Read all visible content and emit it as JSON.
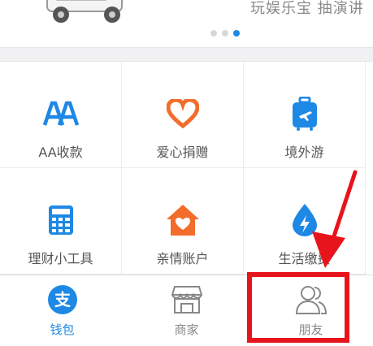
{
  "banner": {
    "text": "玩娱乐宝 抽演讲",
    "dots": 3,
    "active_dot": 3
  },
  "grid": [
    {
      "label": "AA收款",
      "icon": "aa-icon",
      "color": "#1e88e5"
    },
    {
      "label": "爱心捐赠",
      "icon": "heart-icon",
      "color": "#f26c2b"
    },
    {
      "label": "境外游",
      "icon": "suitcase-icon",
      "color": "#1e88e5"
    },
    {
      "label": "理财小工具",
      "icon": "calculator-icon",
      "color": "#1e88e5"
    },
    {
      "label": "亲情账户",
      "icon": "house-heart-icon",
      "color": "#f26c2b"
    },
    {
      "label": "生活缴费",
      "icon": "water-lightning-icon",
      "color": "#1e88e5"
    }
  ],
  "tabbar": {
    "tabs": [
      {
        "label": "钱包",
        "icon": "alipay-icon",
        "active": true
      },
      {
        "label": "商家",
        "icon": "shop-icon",
        "active": false
      },
      {
        "label": "朋友",
        "icon": "friends-icon",
        "active": false
      }
    ]
  },
  "colors": {
    "accent": "#1e88e5",
    "orange": "#f26c2b",
    "annotation": "#e8141b"
  }
}
